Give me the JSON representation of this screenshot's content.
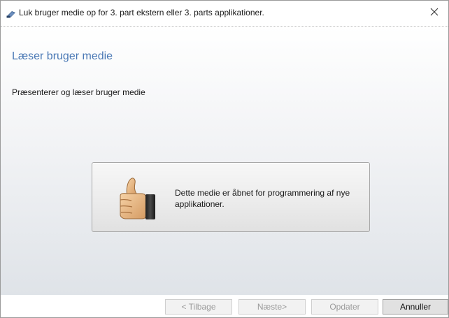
{
  "window": {
    "title": "Luk bruger medie op for 3. part ekstern eller 3. parts applikationer.",
    "title_icon": "card-reader-icon",
    "close_icon": "close-icon"
  },
  "page": {
    "title": "Læser bruger medie",
    "subtitle": "Præsenterer og læser bruger medie"
  },
  "message": {
    "icon": "thumbs-up-icon",
    "text": "Dette medie er åbnet for programmering af nye applikationer."
  },
  "buttons": {
    "back": "< Tilbage",
    "next": "Næste>",
    "update": "Opdater",
    "cancel": "Annuller"
  },
  "colors": {
    "title_accent": "#4a78b5"
  }
}
